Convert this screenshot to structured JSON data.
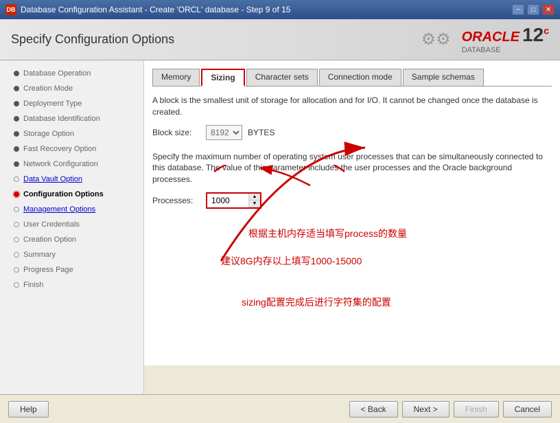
{
  "titleBar": {
    "title": "Database Configuration Assistant - Create 'ORCL' database - Step 9 of 15",
    "iconLabel": "DB",
    "minimizeBtn": "−",
    "maximizeBtn": "□",
    "closeBtn": "✕"
  },
  "header": {
    "title": "Specify Configuration Options",
    "oracleText": "ORACLE",
    "databaseText": "DATABASE",
    "versionText": "12",
    "versionSup": "c"
  },
  "sidebar": {
    "items": [
      {
        "id": "database-operation",
        "label": "Database Operation",
        "state": "done"
      },
      {
        "id": "creation-mode",
        "label": "Creation Mode",
        "state": "done"
      },
      {
        "id": "deployment-type",
        "label": "Deployment Type",
        "state": "done"
      },
      {
        "id": "database-identification",
        "label": "Database Identification",
        "state": "done"
      },
      {
        "id": "storage-option",
        "label": "Storage Option",
        "state": "done"
      },
      {
        "id": "fast-recovery-option",
        "label": "Fast Recovery Option",
        "state": "done"
      },
      {
        "id": "network-configuration",
        "label": "Network Configuration",
        "state": "done"
      },
      {
        "id": "data-vault-option",
        "label": "Data Vault Option",
        "state": "link"
      },
      {
        "id": "configuration-options",
        "label": "Configuration Options",
        "state": "active"
      },
      {
        "id": "management-options",
        "label": "Management Options",
        "state": "link"
      },
      {
        "id": "user-credentials",
        "label": "User Credentials",
        "state": "pending"
      },
      {
        "id": "creation-option",
        "label": "Creation Option",
        "state": "pending"
      },
      {
        "id": "summary",
        "label": "Summary",
        "state": "pending"
      },
      {
        "id": "progress-page",
        "label": "Progress Page",
        "state": "pending"
      },
      {
        "id": "finish",
        "label": "Finish",
        "state": "pending"
      }
    ]
  },
  "tabs": [
    {
      "id": "memory",
      "label": "Memory"
    },
    {
      "id": "sizing",
      "label": "Sizing",
      "active": true
    },
    {
      "id": "character-sets",
      "label": "Character sets"
    },
    {
      "id": "connection-mode",
      "label": "Connection mode"
    },
    {
      "id": "sample-schemas",
      "label": "Sample schemas"
    }
  ],
  "sizing": {
    "blockSizeDesc": "A block is the smallest unit of storage for allocation and for I/O. It cannot be changed once the database is created.",
    "blockSizeLabel": "Block size:",
    "blockSizeValue": "8192",
    "blockSizeOptions": [
      "8192"
    ],
    "blockSizeUnit": "BYTES",
    "processesDesc": "Specify the maximum number of operating system user processes that can be simultaneously connected to this database. The value of this parameter includes the user processes and the Oracle background processes.",
    "processesLabel": "Processes:",
    "processesValue": "1000"
  },
  "annotations": {
    "text1": "根据主机内存适当填写process的数量",
    "text2": "建议8G内存以上填写1000-15000",
    "text3": "sizing配置完成后进行字符集的配置"
  },
  "bottomBar": {
    "helpLabel": "Help",
    "backLabel": "< Back",
    "nextLabel": "Next >",
    "finishLabel": "Finish",
    "cancelLabel": "Cancel"
  }
}
